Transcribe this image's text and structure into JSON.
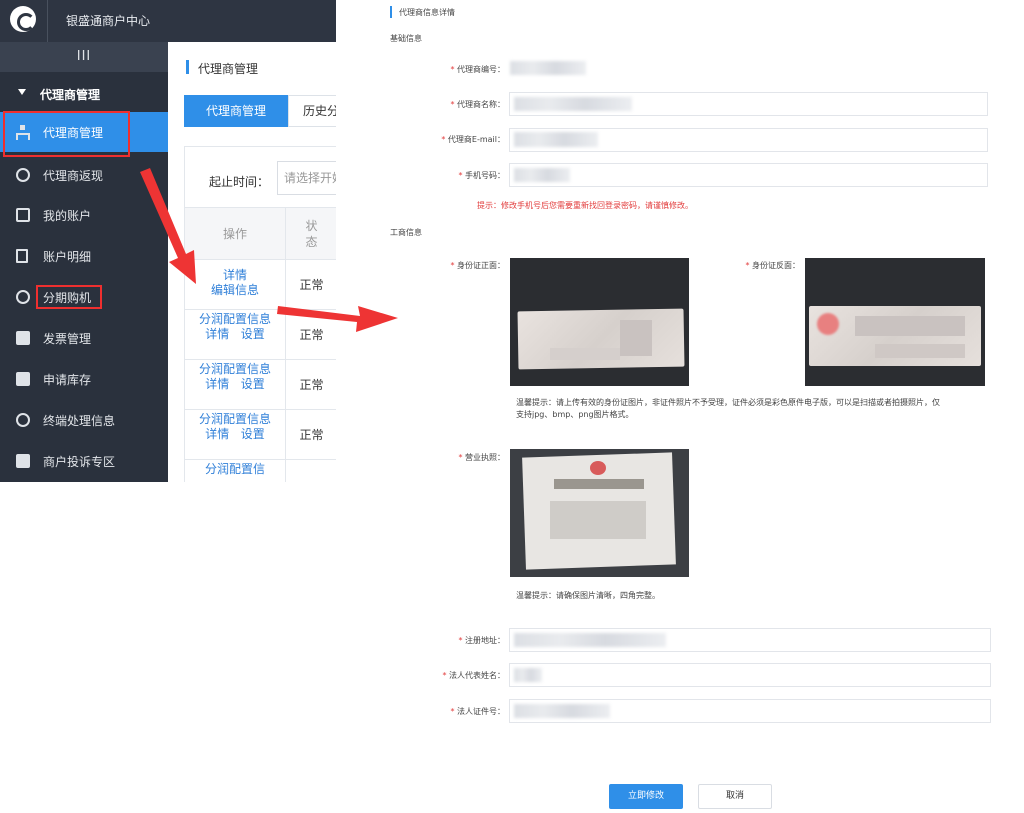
{
  "app": {
    "title": "银盛通商户中心"
  },
  "sidebar": {
    "toggle_label": "III",
    "group_label": "代理商管理",
    "items": [
      {
        "label": "代理商管理",
        "icon": "org-chart-icon"
      },
      {
        "label": "代理商返现",
        "icon": "coin-icon"
      },
      {
        "label": "我的账户",
        "icon": "id-card-icon"
      },
      {
        "label": "账户明细",
        "icon": "document-icon"
      },
      {
        "label": "分期购机",
        "icon": "card-icon"
      },
      {
        "label": "发票管理",
        "icon": "invoice-icon"
      },
      {
        "label": "申请库存",
        "icon": "list-icon"
      },
      {
        "label": "终端处理信息",
        "icon": "terminal-icon"
      },
      {
        "label": "商户投诉专区",
        "icon": "complaint-icon"
      }
    ]
  },
  "list_page": {
    "heading": "代理商管理",
    "tabs": [
      "代理商管理",
      "历史分"
    ],
    "filter_label": "起止时间：",
    "filter_placeholder": "请选择开始",
    "columns": [
      "操作",
      "状态"
    ],
    "rows": [
      {
        "links": [
          "详情",
          "编辑信息"
        ],
        "status": "正常"
      },
      {
        "links": [
          "分润配置信息",
          "详情",
          "设置"
        ],
        "status": "正常"
      },
      {
        "links": [
          "分润配置信息",
          "详情",
          "设置"
        ],
        "status": "正常"
      },
      {
        "links": [
          "分润配置信息",
          "详情",
          "设置"
        ],
        "status": "正常"
      },
      {
        "links": [
          "分润配置信"
        ],
        "status": ""
      }
    ]
  },
  "detail_form": {
    "title": "代理商信息详情",
    "basic_section": "基础信息",
    "fields": {
      "agent_no": "代理商编号：",
      "agent_name": "代理商名称：",
      "agent_email": "代理商E-mail：",
      "mobile": "手机号码："
    },
    "mobile_tip": "提示：修改手机号后您需要重新找回登录密码，请谨慎修改。",
    "business_section": "工商信息",
    "id_front": "身份证正面：",
    "id_back": "身份证反面：",
    "id_tip_line1": "温馨提示：请上传有效的身份证图片，非证件照片不予受理，证件必须是彩色原件电子版，可以是扫描或者拍摄照片，仅",
    "id_tip_line2": "支持jpg、bmp、png图片格式。",
    "license": "营业执照：",
    "license_tip": "温馨提示：请确保图片清晰，四角完整。",
    "reg_address": "注册地址：",
    "legal_name": "法人代表姓名：",
    "legal_id": "法人证件号：",
    "submit": "立即修改",
    "cancel": "取消"
  },
  "colors": {
    "accent": "#2f8fe8",
    "sidebar": "#2a313d",
    "highlight": "#ef2f2f"
  }
}
